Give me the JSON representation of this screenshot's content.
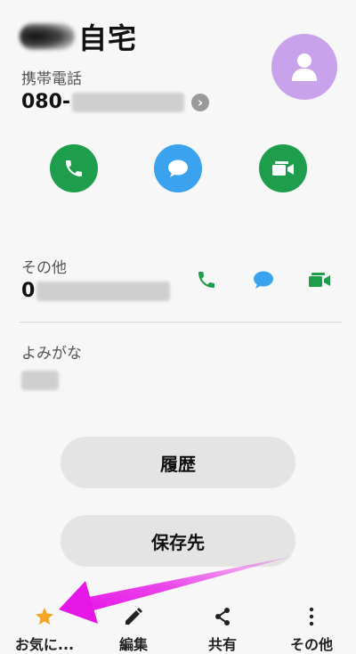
{
  "contact": {
    "title": "自宅",
    "primary_label": "携帯電話",
    "primary_number": "080-",
    "other_label": "その他",
    "other_number": "0",
    "reading_label": "よみがな"
  },
  "actions": {
    "history": "履歴",
    "save_to": "保存先"
  },
  "bottom_nav": [
    {
      "label": "お気に...",
      "icon": "star-icon"
    },
    {
      "label": "編集",
      "icon": "pencil-icon"
    },
    {
      "label": "共有",
      "icon": "share-icon"
    },
    {
      "label": "その他",
      "icon": "more-vertical-icon"
    }
  ],
  "colors": {
    "call_green": "#1e9d4d",
    "message_blue": "#3aa2ee",
    "avatar_purple": "#c9a2ec",
    "favorite_star": "#f5a623",
    "annotation_arrow": "#e617e6"
  }
}
